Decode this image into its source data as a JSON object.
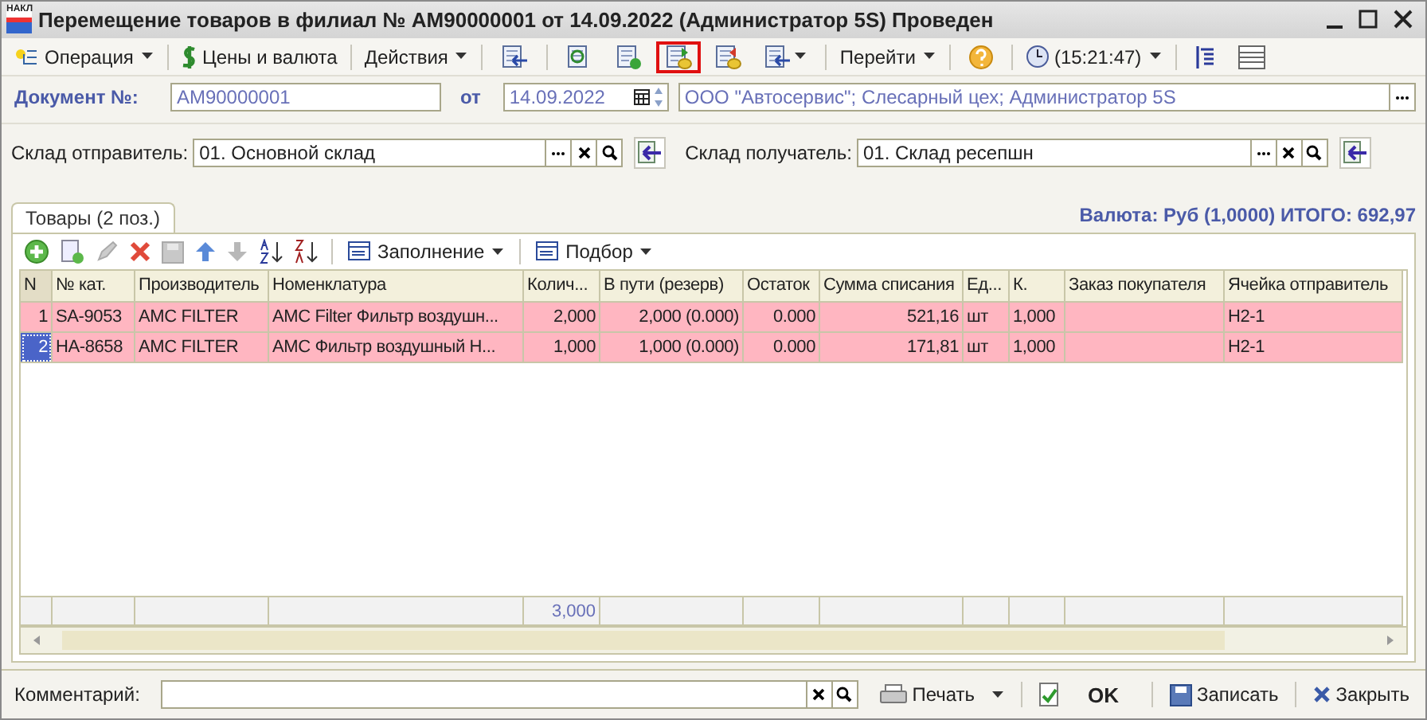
{
  "window": {
    "title": "Перемещение товаров в филиал № АМ90000001 от 14.09.2022 (Администратор 5S) Проведен",
    "app_badge": "НАКЛ"
  },
  "toolbar": [
    {
      "kind": "menu",
      "label": "Операция"
    },
    {
      "kind": "button",
      "label": "Цены и валюта"
    },
    {
      "kind": "menu",
      "label": "Действия"
    },
    {
      "kind": "icon",
      "highlighted": false
    },
    {
      "kind": "icon",
      "highlighted": false
    },
    {
      "kind": "icon",
      "highlighted": false
    },
    {
      "kind": "icon",
      "highlighted": true
    },
    {
      "kind": "icon",
      "highlighted": false
    },
    {
      "kind": "iconmenu",
      "highlighted": false
    },
    {
      "kind": "menu",
      "label": "Перейти"
    },
    {
      "kind": "icon",
      "highlighted": false
    },
    {
      "kind": "clock",
      "label": "(15:21:47)"
    },
    {
      "kind": "icon",
      "highlighted": false
    },
    {
      "kind": "icon",
      "highlighted": false
    }
  ],
  "document": {
    "number_label": "Документ №:",
    "number": "АМ90000001",
    "date_label": "от",
    "date": "14.09.2022",
    "organization": "ООО \"Автосервис\"; Слесарный цех; Администратор 5S"
  },
  "sender": {
    "label": "Склад отправитель:",
    "value": "01.  Основной склад"
  },
  "receiver": {
    "label": "Склад получатель:",
    "value": "01. Склад ресепшн"
  },
  "tabs": [
    {
      "label": "Товары (2 поз.)",
      "selected": true
    }
  ],
  "totals": "Валюта: Руб (1,0000) ИТОГО: 692,97",
  "table_toolbar": [
    {
      "kind": "menu",
      "label": "Заполнение"
    },
    {
      "kind": "menu",
      "label": "Подбор"
    }
  ],
  "table": {
    "columns": [
      "N",
      "№ кат.",
      "Производитель",
      "Номенклатура",
      "Колич...",
      "В пути (резерв)",
      "Остаток",
      "Сумма списания",
      "Ед...",
      "К.",
      "Заказ покупателя",
      "Ячейка отправитель"
    ],
    "rows": [
      {
        "selected": false,
        "cells": [
          "1",
          "SA-9053",
          "AMC FILTER",
          "AMC Filter Фильтр воздушн...",
          "2,000",
          "2,000 (0.000)",
          "0.000",
          "521,16",
          "шт",
          "1,000",
          "",
          "H2-1"
        ]
      },
      {
        "selected": true,
        "cells": [
          "2",
          "HA-8658",
          "AMC FILTER",
          "AMC Фильтр воздушный Н...",
          "1,000",
          "1,000 (0.000)",
          "0.000",
          "171,81",
          "шт",
          "1,000",
          "",
          "H2-1"
        ]
      }
    ],
    "footer": {
      "quantity_total": "3,000"
    }
  },
  "comment": {
    "label": "Комментарий:"
  },
  "buttons": [
    {
      "kind": "print",
      "label": "Печать"
    },
    {
      "kind": "ok",
      "label": "OK"
    },
    {
      "kind": "save",
      "label": "Записать"
    },
    {
      "kind": "close",
      "label": "Закрыть"
    }
  ]
}
